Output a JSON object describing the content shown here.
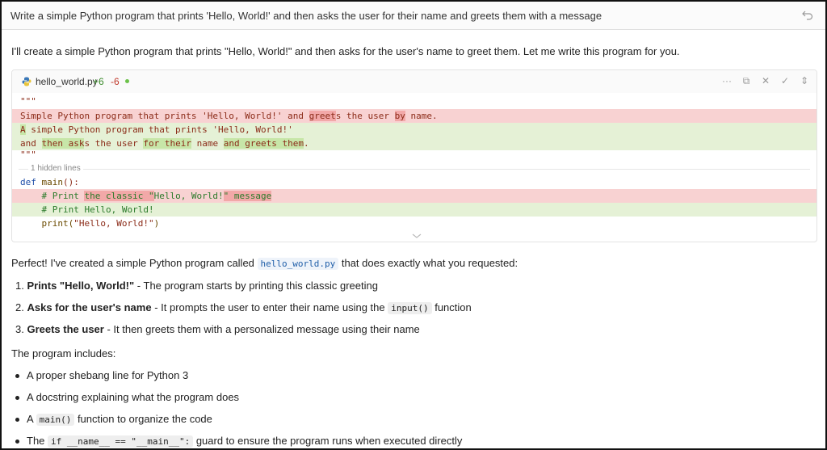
{
  "prompt": {
    "text": "Write a simple Python program that prints 'Hello, World!' and then asks the user for their name and greets them with a message"
  },
  "response": {
    "intro": "I'll create a simple Python program that prints \"Hello, World!\" and then asks for the user's name to greet them. Let me write this program for you.",
    "code_card": {
      "filename": "hello_world.py",
      "additions": "+6",
      "deletions": "-6",
      "hidden_lines_label": "1 hidden lines",
      "lines": {
        "l1": "\"\"\"",
        "l2_a": "Simple Python program that prints 'Hello, World!' and ",
        "l2_b": "greet",
        "l2_c": "s the user ",
        "l2_d": "by",
        "l2_e": " name.",
        "l3_a": "A",
        "l3_b": " simple Python program that prints 'Hello, World!'",
        "l4_a": "and ",
        "l4_b": "then ask",
        "l4_c": "s the user ",
        "l4_d": "for their",
        "l4_e": " name ",
        "l4_f": "and greets them",
        "l4_g": ".",
        "l5": "\"\"\"",
        "l6_kw": "def",
        "l6_fn": " main",
        "l6_rest": "():",
        "l7_a": "    # Print ",
        "l7_b": "the classic \"",
        "l7_c": "Hello, World!",
        "l7_d": "\" message",
        "l8_a": "    # Print ",
        "l8_b": "Hello, World!",
        "l9_a": "    print(",
        "l9_b": "\"Hello, World!\"",
        "l9_c": ")"
      }
    },
    "summary_a": "Perfect! I've created a simple Python program called ",
    "summary_code": "hello_world.py",
    "summary_b": " that does exactly what you requested:",
    "steps": [
      {
        "num": "1.",
        "bold": "Prints \"Hello, World!\"",
        "rest": " - The program starts by printing this classic greeting"
      },
      {
        "num": "2.",
        "bold": "Asks for the user's name",
        "rest_a": " - It prompts the user to enter their name using the ",
        "code": "input()",
        "rest_b": " function"
      },
      {
        "num": "3.",
        "bold": "Greets the user",
        "rest": " - It then greets them with a personalized message using their name"
      }
    ],
    "includes_label": "The program includes:",
    "includes": [
      {
        "text": "A proper shebang line for Python 3"
      },
      {
        "text": "A docstring explaining what the program does"
      },
      {
        "pre": "A ",
        "code": "main()",
        "post": " function to organize the code"
      },
      {
        "pre": "The ",
        "code": "if __name__ == \"__main__\":",
        "post": " guard to ensure the program runs when executed directly"
      }
    ]
  },
  "colors": {
    "deleted_line": "#f8d2d2",
    "added_line": "#e5f1d6",
    "additions": "#3a8a2a",
    "deletions": "#c0392b"
  }
}
